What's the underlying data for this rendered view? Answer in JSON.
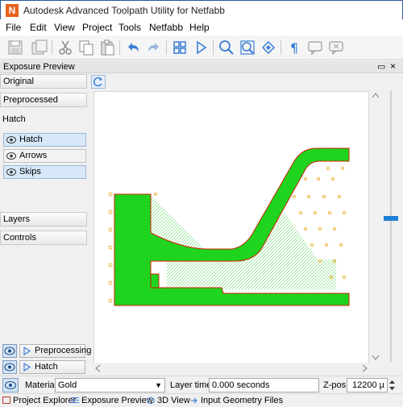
{
  "window": {
    "title": "Autodesk Advanced Toolpath Utility for Netfabb",
    "app_icon_letter": "N"
  },
  "menu": [
    "File",
    "Edit",
    "View",
    "Project",
    "Tools",
    "Netfabb",
    "Help"
  ],
  "toolbar_icons": [
    "save-icon",
    "save-as-icon",
    "cut-icon",
    "copy-icon",
    "paste-icon",
    "undo-icon",
    "redo-icon",
    "grid-icon",
    "play-icon",
    "zoom-icon",
    "zoom-fit-icon",
    "rotate-icon",
    "paragraph-icon",
    "comment-icon",
    "comment-delete-icon"
  ],
  "panel": {
    "title": "Exposure Preview",
    "float_glyph": "▭",
    "close_glyph": "×"
  },
  "sidebar": {
    "original": "Original",
    "preprocessed": "Preprocessed",
    "hatch_section": "Hatch",
    "toggles": [
      {
        "label": "Hatch",
        "on": true
      },
      {
        "label": "Arrows",
        "on": false
      },
      {
        "label": "Skips",
        "on": true
      }
    ],
    "layers": "Layers",
    "controls": "Controls",
    "bottom_tools": [
      {
        "label": "Preprocessing"
      },
      {
        "label": "Hatch"
      }
    ]
  },
  "status": {
    "material_label": "Material",
    "material_value": "Gold",
    "layer_time_label": "Layer time",
    "layer_time_value": "0.000 seconds",
    "zpos_label": "Z-pos",
    "zpos_value": "12200 µ"
  },
  "tabs": [
    "Project Explorer",
    "Exposure Preview",
    "3D View",
    "Input Geometry Files"
  ],
  "colors": {
    "hatch_fill": "#22e022",
    "outline": "#cc2200",
    "skip_dot": "#e0a000",
    "accent": "#1e7fd6"
  }
}
